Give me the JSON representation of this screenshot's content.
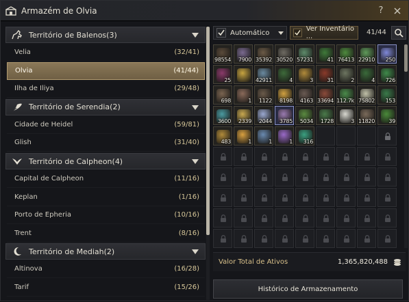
{
  "window": {
    "title": "Armazém de Olvia"
  },
  "regions": [
    {
      "label": "Território de Balenos(3)",
      "icon": "horse-icon",
      "towns": [
        {
          "name": "Velia",
          "count": "(32/41)",
          "selected": false
        },
        {
          "name": "Olvia",
          "count": "(41/44)",
          "selected": true
        },
        {
          "name": "Ilha de Iliya",
          "count": "(29/48)",
          "selected": false
        }
      ]
    },
    {
      "label": "Território de Serendia(2)",
      "icon": "feather-icon",
      "towns": [
        {
          "name": "Cidade de Heidel",
          "count": "(59/81)",
          "selected": false
        },
        {
          "name": "Glish",
          "count": "(31/40)",
          "selected": false
        }
      ]
    },
    {
      "label": "Território de Calpheon(4)",
      "icon": "wings-icon",
      "towns": [
        {
          "name": "Capital de Calpheon",
          "count": "(11/16)",
          "selected": false
        },
        {
          "name": "Keplan",
          "count": "(1/16)",
          "selected": false
        },
        {
          "name": "Porto de Epheria",
          "count": "(10/16)",
          "selected": false
        },
        {
          "name": "Trent",
          "count": "(8/16)",
          "selected": false
        }
      ]
    },
    {
      "label": "Território de Mediah(2)",
      "icon": "moon-icon",
      "towns": [
        {
          "name": "Altinova",
          "count": "(16/28)",
          "selected": false
        },
        {
          "name": "Tarif",
          "count": "(15/26)",
          "selected": false
        }
      ]
    }
  ],
  "toolbar": {
    "sort_label": "Automático",
    "inventory_toggle_label": "Ver Inventário ...",
    "capacity": "41/44"
  },
  "items": [
    "98554",
    "7900",
    "35392",
    "30520",
    "57231",
    "41",
    "76413",
    "22910",
    "250",
    "25",
    "",
    "42911",
    "4",
    "3",
    "31",
    "2",
    "4",
    "726",
    "698",
    "1",
    "1122",
    "8198",
    "4163",
    "33694",
    "112.7k",
    "75802",
    "153",
    "3600",
    "2339",
    "2044",
    "3785",
    "5034",
    "1728",
    "3",
    "11820",
    "39",
    "483",
    "1",
    "1",
    "1",
    "316"
  ],
  "item_colors": [
    "#5a4a3a",
    "#7a6a90",
    "#6b5a46",
    "#6e6a62",
    "#5d8a6a",
    "#3f7a3a",
    "#4e8a3e",
    "#5f9a5a",
    "#7f88d8",
    "#8a3a6a",
    "#c7a440",
    "#6a8aa0",
    "#3d6a3a",
    "#b08a3a",
    "#8a3a2a",
    "#6d7560",
    "#3a6a3a",
    "#3f8a4a",
    "#7a6450",
    "#8a6a5a",
    "#6a5a4a",
    "#d0a040",
    "#6a5a52",
    "#8a4a3a",
    "#4a8a4a",
    "#c0c0a8",
    "#3a7a4a",
    "#4a9aa0",
    "#c8a850",
    "#9aa8d0",
    "#9a7ab0",
    "#5a8a40",
    "#4a7a4a",
    "#d8d8d0",
    "#7a6a5a",
    "#4a8a3a",
    "#b08a3a",
    "#d8a040",
    "#6a8ab0",
    "#9a6ac8",
    "#3aa080"
  ],
  "total_slots": 90,
  "valor": {
    "label": "Valor Total de Ativos",
    "value": "1,365,820,488"
  },
  "history_label": "Histórico de Armazenamento"
}
